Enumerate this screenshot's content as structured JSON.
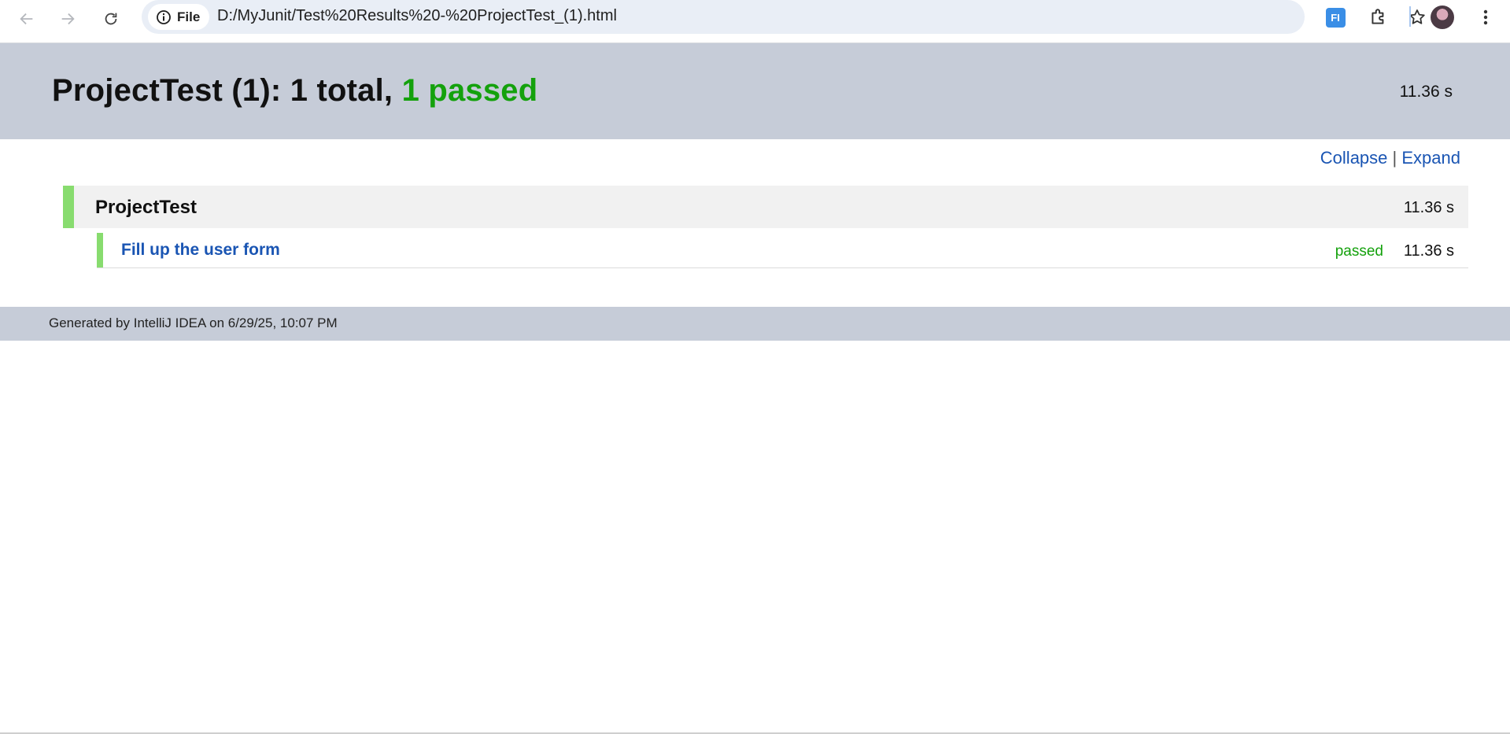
{
  "browser": {
    "site_chip_label": "File",
    "url": "D:/MyJunit/Test%20Results%20-%20ProjectTest_(1).html",
    "extension_label": "FI",
    "icons": {
      "back": "arrow-left-icon",
      "forward": "arrow-right-icon",
      "reload": "reload-icon",
      "info": "info-icon",
      "bookmark": "star-icon",
      "extensions": "puzzle-icon",
      "profile": "avatar",
      "menu": "kebab-menu-icon"
    }
  },
  "report": {
    "title_prefix": "ProjectTest (1):",
    "total_text": "1 total,",
    "passed_text": "1 passed",
    "total_time": "11.36 s",
    "links": {
      "collapse": "Collapse",
      "separator": "|",
      "expand": "Expand"
    },
    "suite": {
      "name": "ProjectTest",
      "time": "11.36 s"
    },
    "tests": [
      {
        "name": "Fill up the user form",
        "status": "passed",
        "time": "11.36 s"
      }
    ],
    "footer": "Generated by IntelliJ IDEA on 6/29/25, 10:07 PM",
    "colors": {
      "header_bg": "#c6ccd8",
      "passed": "#14a10c",
      "bar_green": "#88dc6f",
      "link": "#1a55b3"
    }
  }
}
